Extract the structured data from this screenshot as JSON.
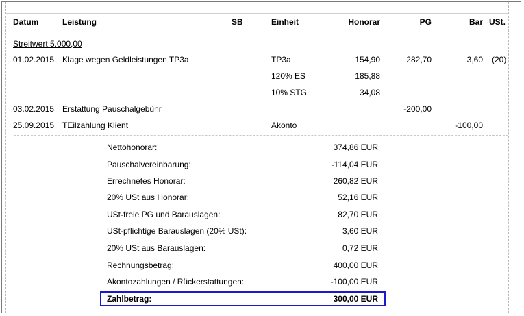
{
  "header": {
    "datum": "Datum",
    "leistung": "Leistung",
    "sb": "SB",
    "einheit": "Einheit",
    "honorar": "Honorar",
    "pg": "PG",
    "bar": "Bar",
    "ust": "USt."
  },
  "streitwert": "Streitwert 5.000,00",
  "rows": [
    {
      "datum": "01.02.2015",
      "leistung": "Klage wegen Geldleistungen TP3a",
      "einheit": "TP3a",
      "honorar": "154,90",
      "pg": "282,70",
      "bar": "3,60",
      "ust": "(20)"
    },
    {
      "datum": "",
      "leistung": "",
      "einheit": "120% ES",
      "honorar": "185,88",
      "pg": "",
      "bar": "",
      "ust": ""
    },
    {
      "datum": "",
      "leistung": "",
      "einheit": "10% STG",
      "honorar": "34,08",
      "pg": "",
      "bar": "",
      "ust": ""
    },
    {
      "datum": "03.02.2015",
      "leistung": "Erstattung Pauschalgebühr",
      "einheit": "",
      "honorar": "",
      "pg": "-200,00",
      "bar": "",
      "ust": ""
    },
    {
      "datum": "25.09.2015",
      "leistung": "TEilzahlung Klient",
      "einheit": "Akonto",
      "honorar": "",
      "pg": "",
      "bar": "-100,00",
      "ust": ""
    }
  ],
  "summary": [
    {
      "label": "Nettohonorar:",
      "value": "374,86 EUR"
    },
    {
      "label": "Pauschalvereinbarung:",
      "value": "-114,04 EUR"
    },
    {
      "label": "Errechnetes Honorar:",
      "value": "260,82 EUR"
    },
    {
      "label": "20% USt aus Honorar:",
      "value": "52,16 EUR"
    },
    {
      "label": "USt-freie PG und Barauslagen:",
      "value": "82,70 EUR"
    },
    {
      "label": "USt-pflichtige Barauslagen (20% USt):",
      "value": "3,60 EUR"
    },
    {
      "label": "20% USt aus Barauslagen:",
      "value": "0,72 EUR"
    },
    {
      "label": "Rechnungsbetrag:",
      "value": "400,00 EUR"
    },
    {
      "label": "Akontozahlungen / Rückerstattungen:",
      "value": "-100,00 EUR"
    }
  ],
  "total": {
    "label": "Zahlbetrag:",
    "value": "300,00 EUR"
  },
  "colors": {
    "highlight_border": "#1a1acc",
    "frame": "#7a7a7a"
  }
}
